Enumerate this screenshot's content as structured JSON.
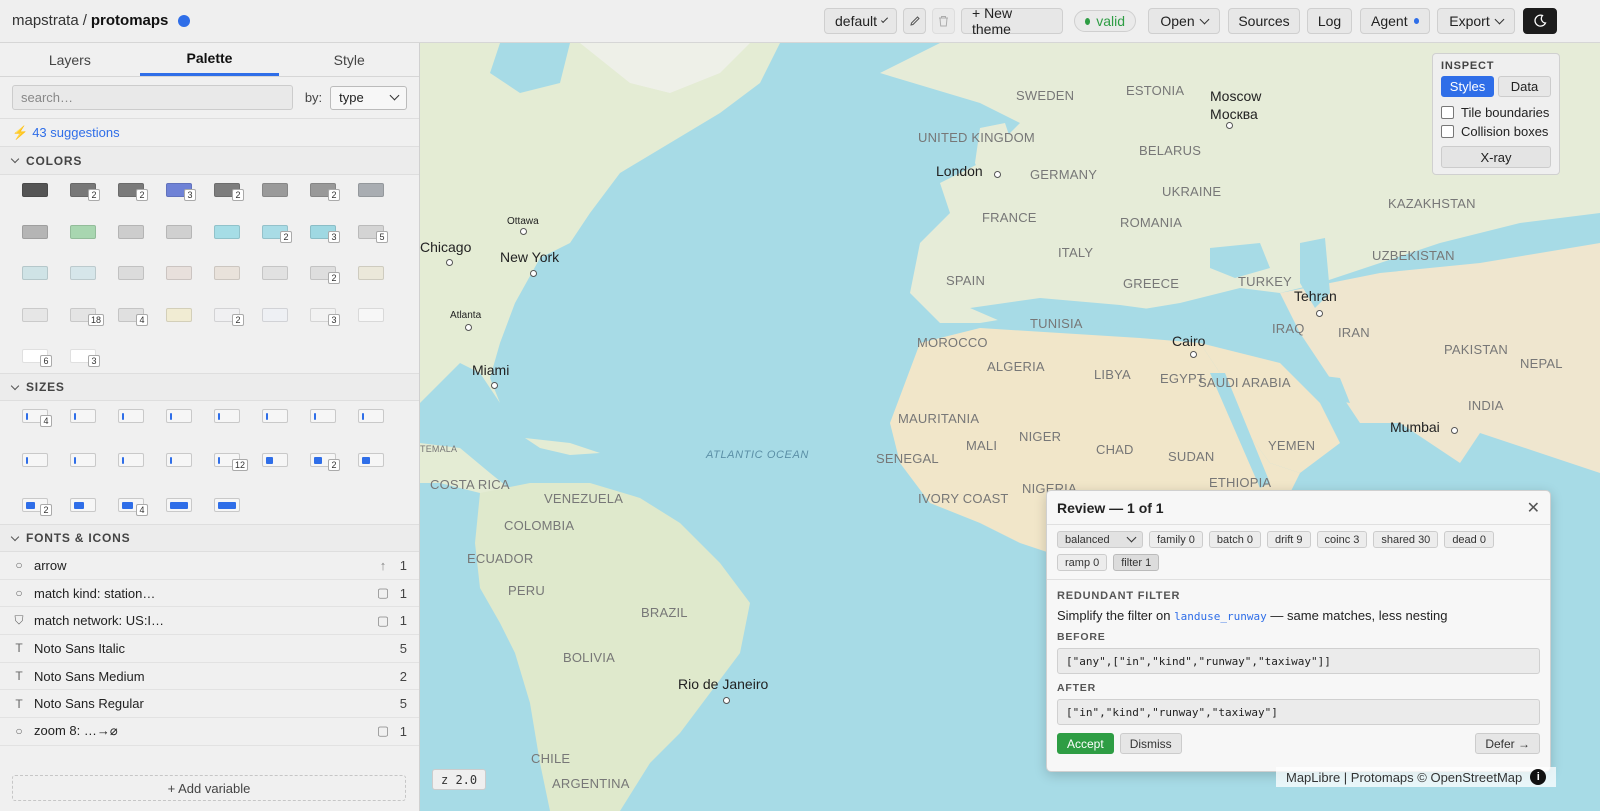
{
  "header": {
    "org": "mapstrata",
    "separator": "/",
    "project": "protomaps",
    "theme_select": "default",
    "new_theme": "+ New theme",
    "status": "valid",
    "open": "Open",
    "sources": "Sources",
    "log": "Log",
    "agent": "Agent",
    "export": "Export",
    "accent": "#2f6ee8",
    "valid_color": "#2e9d44"
  },
  "sidebar": {
    "tabs": [
      "Layers",
      "Palette",
      "Style"
    ],
    "active_tab": "Palette",
    "search_placeholder": "search…",
    "by_label": "by:",
    "by_value": "type",
    "suggestions": "43 suggestions",
    "colors_title": "COLORS",
    "sizes_title": "SIZES",
    "fonts_title": "FONTS & ICONS",
    "colors": [
      {
        "hex": "#555555",
        "n": ""
      },
      {
        "hex": "#777777",
        "n": "2"
      },
      {
        "hex": "#7a7a7a",
        "n": "2"
      },
      {
        "hex": "#6f82d6",
        "n": "3"
      },
      {
        "hex": "#7d7d7d",
        "n": "2"
      },
      {
        "hex": "#9a9a9a",
        "n": ""
      },
      {
        "hex": "#999999",
        "n": "2"
      },
      {
        "hex": "#a9adb2",
        "n": ""
      },
      {
        "hex": "#b5b5b5",
        "n": ""
      },
      {
        "hex": "#a8d6b0",
        "n": ""
      },
      {
        "hex": "#cdcdcd",
        "n": ""
      },
      {
        "hex": "#d0d0d0",
        "n": ""
      },
      {
        "hex": "#a6dde6",
        "n": ""
      },
      {
        "hex": "#a9dce6",
        "n": "2"
      },
      {
        "hex": "#9fd8e2",
        "n": "3"
      },
      {
        "hex": "#d4d4d4",
        "n": "5"
      },
      {
        "hex": "#cfe3e6",
        "n": ""
      },
      {
        "hex": "#d6e6ea",
        "n": ""
      },
      {
        "hex": "#dcdcdc",
        "n": ""
      },
      {
        "hex": "#e8e0dc",
        "n": ""
      },
      {
        "hex": "#e9e2db",
        "n": ""
      },
      {
        "hex": "#e1e1e1",
        "n": ""
      },
      {
        "hex": "#dedede",
        "n": "2"
      },
      {
        "hex": "#ebe8da",
        "n": ""
      },
      {
        "hex": "#e6e6e6",
        "n": ""
      },
      {
        "hex": "#e4e4e4",
        "n": "18"
      },
      {
        "hex": "#e0e0e0",
        "n": "4"
      },
      {
        "hex": "#f1ecd3",
        "n": ""
      },
      {
        "hex": "#f0f0f2",
        "n": "2"
      },
      {
        "hex": "#eef0f4",
        "n": ""
      },
      {
        "hex": "#f2f2f2",
        "n": "3"
      },
      {
        "hex": "#f7f7f7",
        "n": ""
      },
      {
        "hex": "#ffffff",
        "n": "6"
      },
      {
        "hex": "#ffffff",
        "n": "3"
      }
    ],
    "sizes": [
      {
        "f": 0.08,
        "n": "4"
      },
      {
        "f": 0.08,
        "n": ""
      },
      {
        "f": 0.08,
        "n": ""
      },
      {
        "f": 0.08,
        "n": ""
      },
      {
        "f": 0.08,
        "n": ""
      },
      {
        "f": 0.08,
        "n": ""
      },
      {
        "f": 0.08,
        "n": ""
      },
      {
        "f": 0.08,
        "n": ""
      },
      {
        "f": 0.08,
        "n": ""
      },
      {
        "f": 0.08,
        "n": ""
      },
      {
        "f": 0.1,
        "n": ""
      },
      {
        "f": 0.08,
        "n": ""
      },
      {
        "f": 0.1,
        "n": "12"
      },
      {
        "f": 0.35,
        "n": ""
      },
      {
        "f": 0.4,
        "n": "2"
      },
      {
        "f": 0.4,
        "n": ""
      },
      {
        "f": 0.45,
        "n": "2"
      },
      {
        "f": 0.5,
        "n": ""
      },
      {
        "f": 0.55,
        "n": "4"
      },
      {
        "f": 0.92,
        "n": ""
      },
      {
        "f": 0.92,
        "n": ""
      }
    ],
    "fonts": [
      {
        "icon": "circle",
        "name": "arrow",
        "aux": "arrow-up",
        "count": "1"
      },
      {
        "icon": "circle",
        "name": "match kind: station…",
        "aux": "square",
        "count": "1"
      },
      {
        "icon": "shield",
        "name": "match network: US:I…",
        "aux": "square",
        "count": "1"
      },
      {
        "icon": "text",
        "name": "Noto Sans Italic",
        "aux": "",
        "count": "5"
      },
      {
        "icon": "text",
        "name": "Noto Sans Medium",
        "aux": "",
        "count": "2"
      },
      {
        "icon": "text",
        "name": "Noto Sans Regular",
        "aux": "",
        "count": "5"
      },
      {
        "icon": "circle",
        "name": "zoom 8: …→⌀",
        "aux": "square",
        "count": "1"
      }
    ],
    "add_variable": "+ Add variable"
  },
  "map": {
    "cities": [
      {
        "name": "Moscow"
      },
      {
        "name": "Москва"
      },
      {
        "name": "London"
      },
      {
        "name": "Ottawa"
      },
      {
        "name": "Chicago"
      },
      {
        "name": "New York"
      },
      {
        "name": "Atlanta"
      },
      {
        "name": "Miami"
      },
      {
        "name": "Tehran"
      },
      {
        "name": "Cairo"
      },
      {
        "name": "Mumbai"
      },
      {
        "name": "Rio de Janeiro"
      }
    ],
    "countries": [
      "SWEDEN",
      "ESTONIA",
      "UNITED KINGDOM",
      "BELARUS",
      "GERMANY",
      "UKRAINE",
      "FRANCE",
      "ROMANIA",
      "KAZAKHSTAN",
      "ITALY",
      "SPAIN",
      "GREECE",
      "TURKEY",
      "UZBEKISTAN",
      "TUNISIA",
      "IRAQ",
      "IRAN",
      "MOROCCO",
      "ALGERIA",
      "LIBYA",
      "EGYPT",
      "SAUDI ARABIA",
      "PAKISTAN",
      "NEPAL",
      "INDIA",
      "MAURITANIA",
      "MALI",
      "NIGER",
      "CHAD",
      "SUDAN",
      "YEMEN",
      "SENEGAL",
      "IVORY COAST",
      "NIGERIA",
      "ETHIOPIA",
      "COSTA RICA",
      "VENEZUELA",
      "COLOMBIA",
      "ECUADOR",
      "PERU",
      "BRAZIL",
      "BOLIVIA",
      "CHILE",
      "ARGENTINA",
      "TEMALA"
    ],
    "ocean": "ATLANTIC OCEAN",
    "zoom": "z 2.0",
    "attribution": "MapLibre | Protomaps © OpenStreetMap",
    "water_color": "#a7dbe6"
  },
  "inspect": {
    "title": "INSPECT",
    "styles": "Styles",
    "data": "Data",
    "tile_boundaries": "Tile boundaries",
    "collision_boxes": "Collision boxes",
    "xray": "X-ray"
  },
  "review": {
    "title": "Review — 1 of 1",
    "mode": "balanced",
    "chips": [
      "family 0",
      "batch 0",
      "drift 9",
      "coinc 3",
      "shared 30",
      "dead 0",
      "ramp 0",
      "filter 1"
    ],
    "kind": "REDUNDANT FILTER",
    "msg_pre": "Simplify the filter on",
    "msg_code": "landuse_runway",
    "msg_post": "— same matches, less nesting",
    "before_label": "BEFORE",
    "before": "[\"any\",[\"in\",\"kind\",\"runway\",\"taxiway\"]]",
    "after_label": "AFTER",
    "after": "[\"in\",\"kind\",\"runway\",\"taxiway\"]",
    "accept": "Accept",
    "dismiss": "Dismiss",
    "defer": "Defer →"
  }
}
